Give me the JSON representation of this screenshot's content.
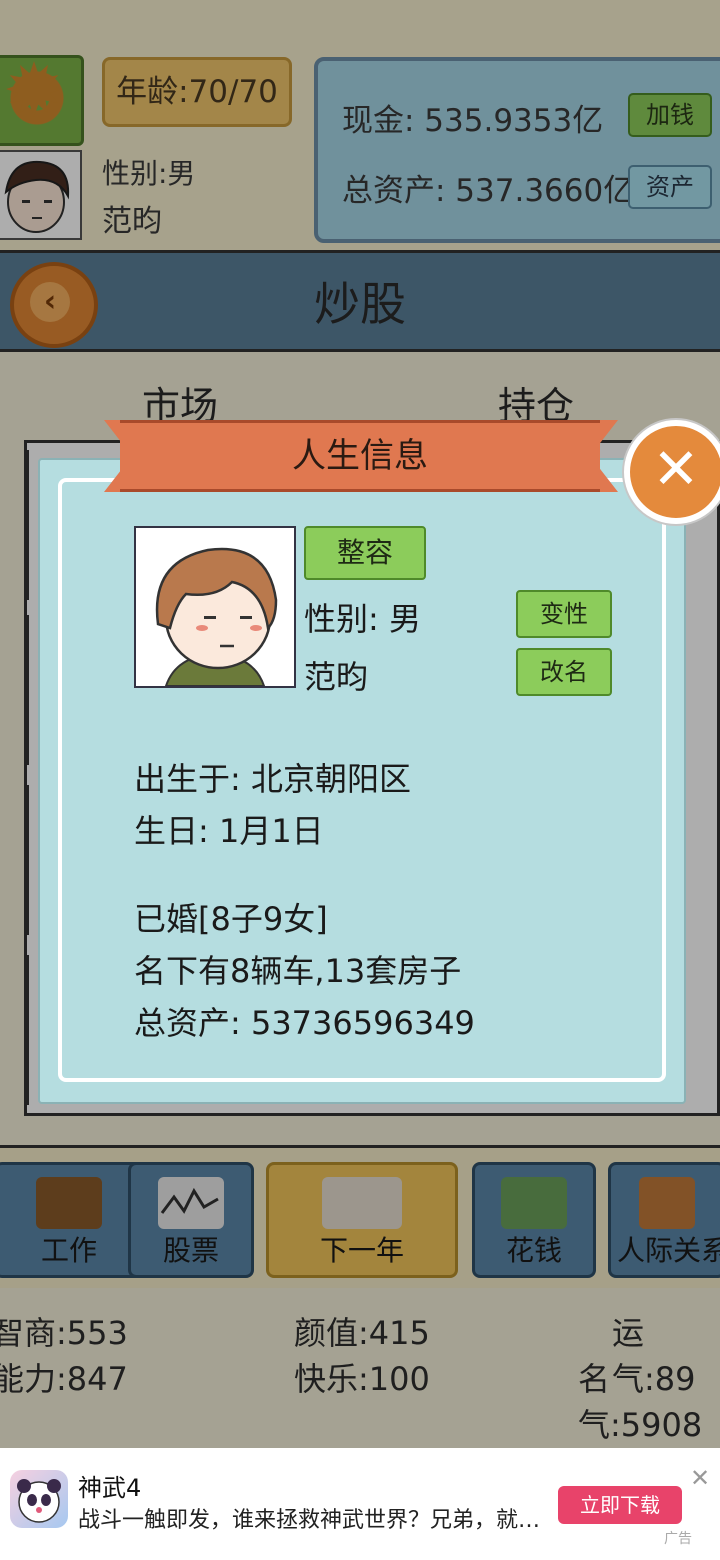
{
  "header": {
    "age": "年龄:70/70",
    "gender": "性别:男",
    "name": "范昀",
    "cash": "现金: 535.9353亿",
    "total_assets": "总资产: 537.3660亿",
    "add_money_label": "加钱",
    "assets_label": "资产"
  },
  "page": {
    "title": "炒股",
    "tabs": [
      "市场",
      "持仓"
    ]
  },
  "bottom_nav": [
    {
      "label": "工作",
      "icon": "briefcase-icon"
    },
    {
      "label": "股票",
      "icon": "chart-icon"
    },
    {
      "label": "下一年",
      "icon": "calendar-icon"
    },
    {
      "label": "花钱",
      "icon": "money-icon"
    },
    {
      "label": "人际关系",
      "icon": "people-icon"
    }
  ],
  "stats": {
    "iq": "智商:553",
    "looks": "颜值:415",
    "luck": "运气:89",
    "ability": "能力:847",
    "happiness": "快乐:100",
    "fame": "名气:5908"
  },
  "modal": {
    "title": "人生信息",
    "surgery_label": "整容",
    "gender": "性别: 男",
    "name": "范昀",
    "change_sex_label": "变性",
    "rename_label": "改名",
    "birthplace": "出生于: 北京朝阳区",
    "birthday": "生日: 1月1日",
    "marriage": "已婚[8子9女]",
    "property": "名下有8辆车,13套房子",
    "total_assets": "总资产: 53736596349"
  },
  "ad": {
    "title": "神武4",
    "description": "战斗一触即发，谁来拯救神武世界？兄弟，就等...",
    "cta": "立即下载",
    "tag": "广告",
    "close": "✕"
  },
  "colors": {
    "modal_bg": "#b5dde0",
    "ribbon": "#e07850",
    "green_button": "#8ccc5b",
    "ad_cta": "#e8436a"
  }
}
